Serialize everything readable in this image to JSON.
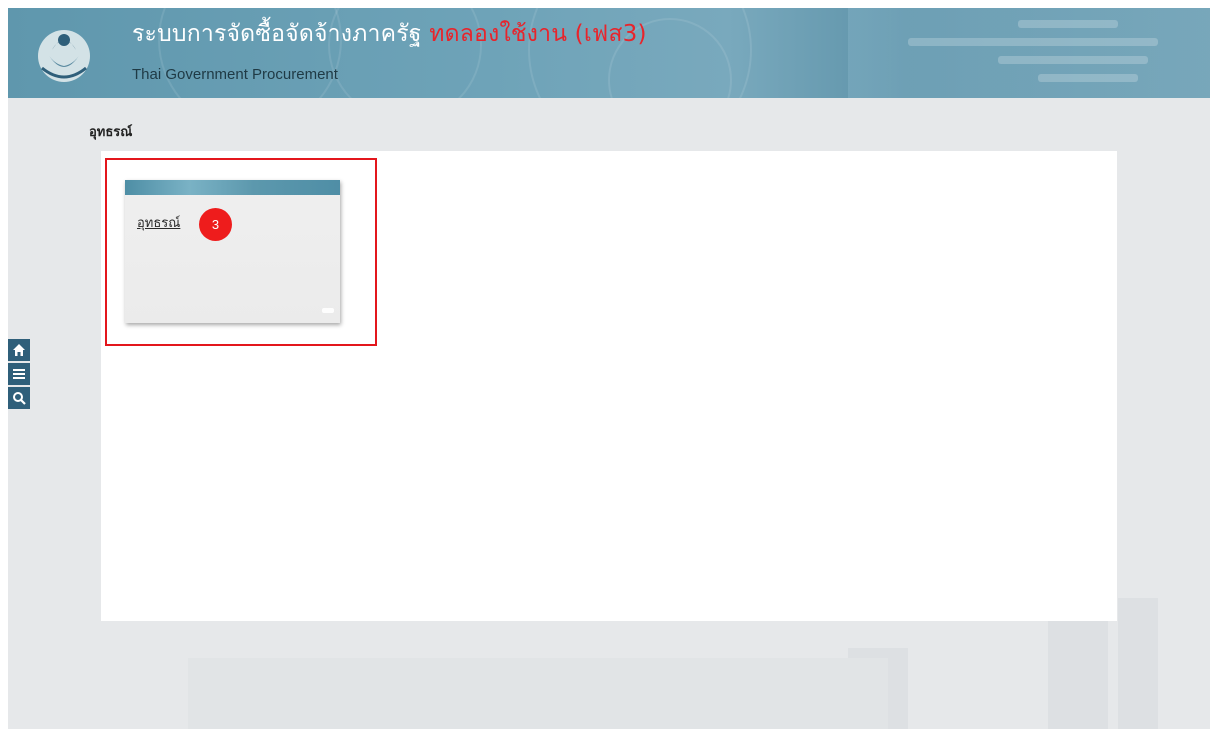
{
  "header": {
    "title_main": "ระบบการจัดซื้อจัดจ้างภาครัฐ",
    "title_trial": "ทดลองใช้งาน (เฟส3)",
    "subtitle": "Thai Government Procurement",
    "logo_icon": "comptroller-general-garuda-emblem"
  },
  "page": {
    "title": "อุทธรณ์"
  },
  "menu_card": {
    "link_label": "อุทธรณ์"
  },
  "annotation": {
    "step_number": "3",
    "highlight_color": "#e3161c",
    "badge_color": "#ee1c1c"
  },
  "side_toolbar": {
    "items": [
      {
        "icon": "home-icon"
      },
      {
        "icon": "menu-icon"
      },
      {
        "icon": "search-icon"
      }
    ],
    "color": "#2f5f7a"
  },
  "colors": {
    "header_accent": "#5f97ad",
    "trial_text": "#e8242b",
    "page_background": "#e6e8ea"
  }
}
